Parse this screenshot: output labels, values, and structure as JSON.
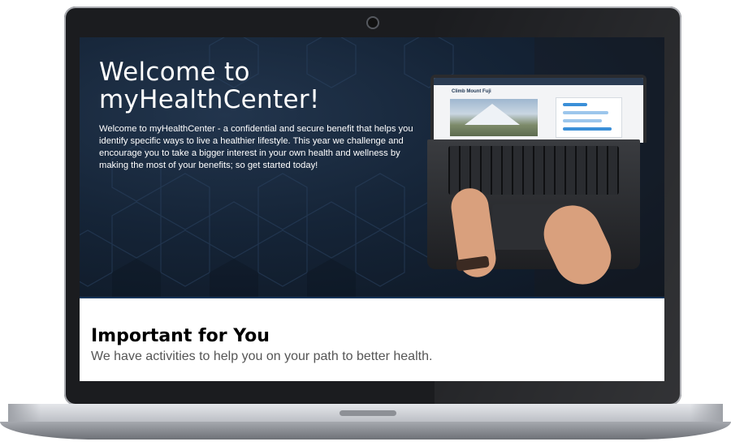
{
  "hero": {
    "title_line1": "Welcome to",
    "title_line2": "myHealthCenter!",
    "body": "Welcome to myHealthCenter - a confidential and secure benefit that helps you identify specific ways to live a healthier lifestyle. This year we challenge and encourage you to take a bigger interest in your own health and wellness by making the most of your benefits; so get started today!",
    "background_color": "#152437"
  },
  "inner_screen": {
    "title": "Climb Mount Fuji"
  },
  "important": {
    "title": "Important for You",
    "subtitle": "We have activities to help you on your path to better health."
  },
  "colors": {
    "accent_rule": "#17355a",
    "laptop_bezel": "#1b1c1f"
  }
}
